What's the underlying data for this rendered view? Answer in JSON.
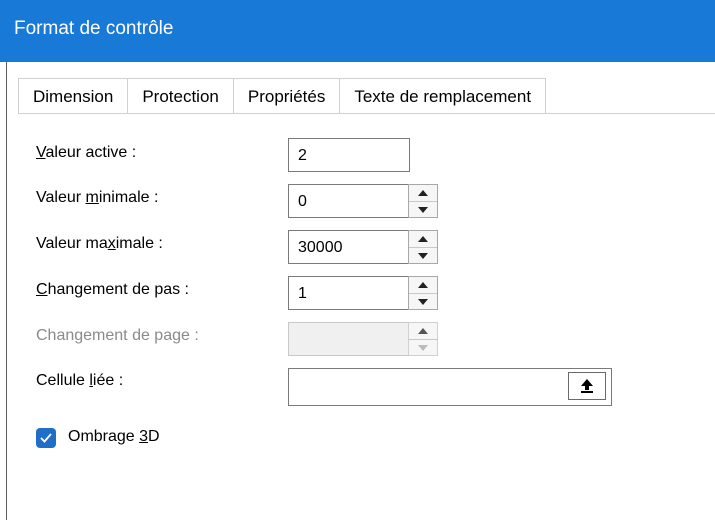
{
  "window": {
    "title": "Format de contrôle"
  },
  "tabs": [
    {
      "label": "Dimension"
    },
    {
      "label": "Protection"
    },
    {
      "label": "Propriétés"
    },
    {
      "label": "Texte de remplacement"
    }
  ],
  "fields": {
    "valeur_active": {
      "label_pre": "",
      "label_u": "V",
      "label_post": "aleur active :",
      "value": "2"
    },
    "valeur_minimale": {
      "label_pre": "Valeur ",
      "label_u": "m",
      "label_post": "inimale :",
      "value": "0"
    },
    "valeur_maximale": {
      "label_pre": "Valeur ma",
      "label_u": "x",
      "label_post": "imale :",
      "value": "30000"
    },
    "changement_pas": {
      "label_pre": "",
      "label_u": "C",
      "label_post": "hangement de pas :",
      "value": "1"
    },
    "changement_page": {
      "label": "Changement de page :",
      "value": ""
    },
    "cellule_liee": {
      "label_pre": "Cellule ",
      "label_u": "l",
      "label_post": "iée :",
      "value": ""
    }
  },
  "checkbox": {
    "label_pre": "Ombrage ",
    "label_u": "3",
    "label_post": "D",
    "checked": true
  },
  "colors": {
    "titlebar": "#1979d6",
    "checkbox": "#1f6ec8",
    "disabled_text": "#8a8a8a"
  },
  "icons": {
    "spin_up": "triangle-up-icon",
    "spin_down": "triangle-down-icon",
    "collapse": "arrow-up-icon",
    "check": "checkmark-icon"
  }
}
